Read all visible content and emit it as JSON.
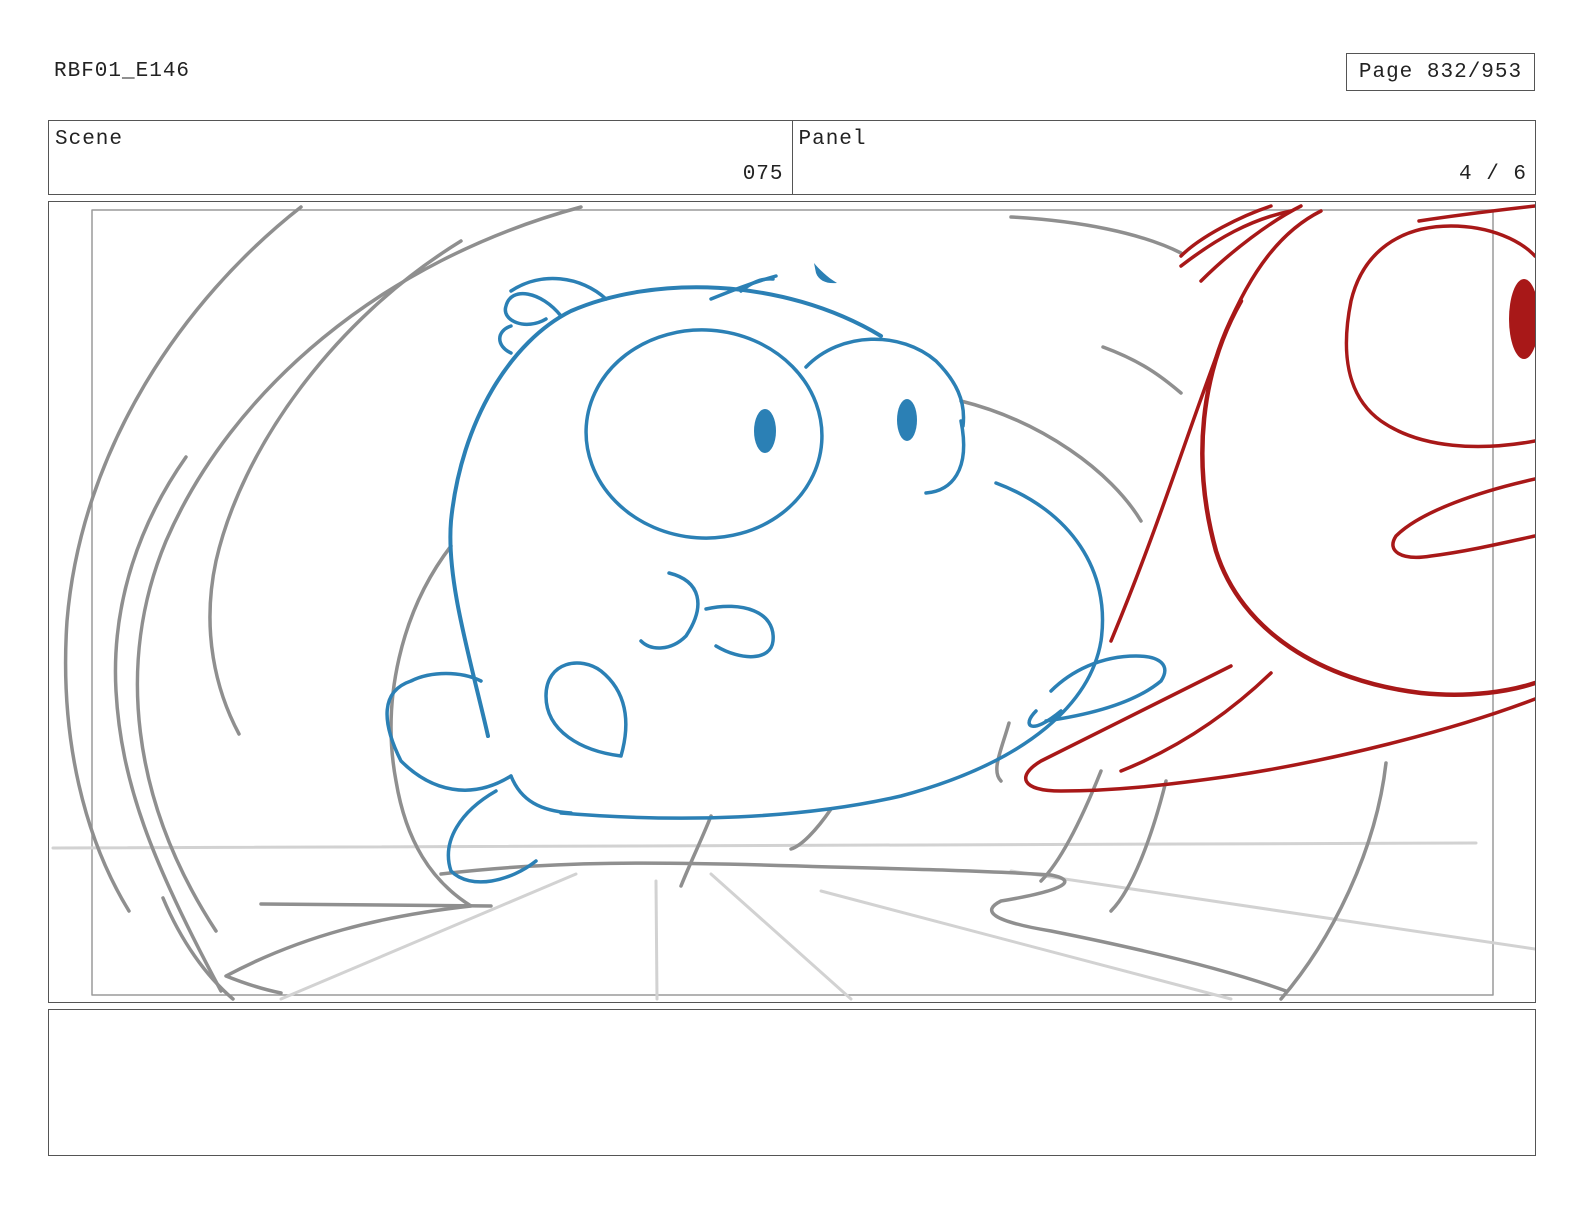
{
  "header": {
    "production_code": "RBF01_E146",
    "page_label": "Page 832/953"
  },
  "scene": {
    "label": "Scene",
    "value": "075"
  },
  "panel": {
    "label": "Panel",
    "value": "4 / 6"
  },
  "artwork": {
    "description_icon": "storyboard-sketch",
    "colors": {
      "rough": "#8f8f8f",
      "light_rough": "#d2d2d2",
      "blue_character": "#2b80b5",
      "red_character": "#a81818"
    }
  },
  "notes": {
    "text": ""
  }
}
